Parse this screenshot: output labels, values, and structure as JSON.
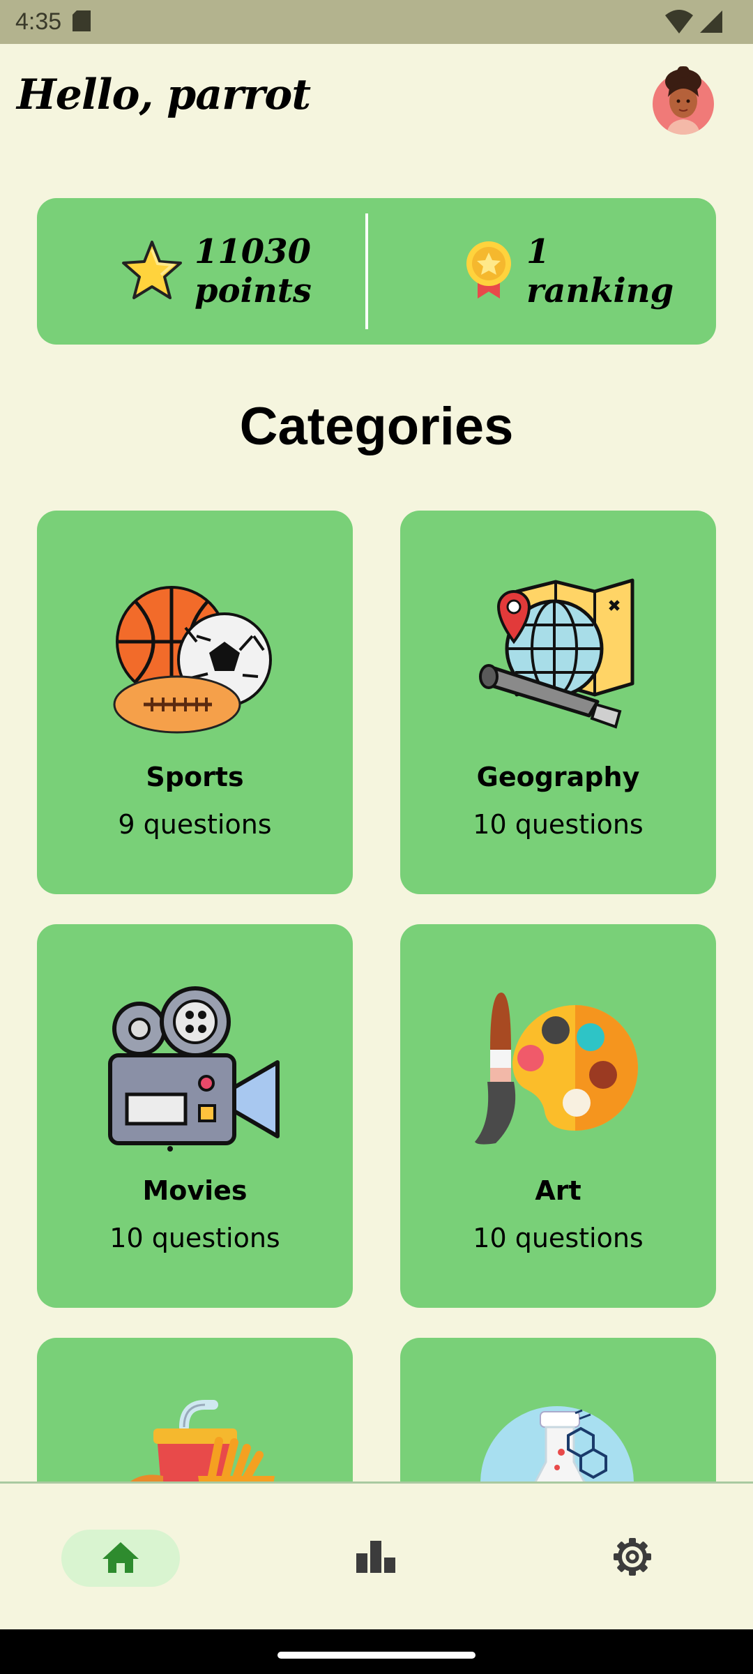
{
  "status_bar": {
    "time": "4:35"
  },
  "header": {
    "greeting": "Hello, parrot"
  },
  "stats": {
    "points_value": "11030",
    "points_label": "points",
    "ranking_value": "1",
    "ranking_label": "ranking"
  },
  "section_title": "Categories",
  "categories": [
    {
      "name": "Sports",
      "count": "9 questions",
      "icon": "sports-balls-icon"
    },
    {
      "name": "Geography",
      "count": "10 questions",
      "icon": "globe-map-icon"
    },
    {
      "name": "Movies",
      "count": "10 questions",
      "icon": "movie-camera-icon"
    },
    {
      "name": "Art",
      "count": "10 questions",
      "icon": "palette-brush-icon"
    },
    {
      "name": "",
      "count": "",
      "icon": "food-drink-icon"
    },
    {
      "name": "",
      "count": "",
      "icon": "science-flask-icon"
    }
  ],
  "bottom_nav": [
    {
      "name": "home",
      "icon": "home-icon",
      "active": true
    },
    {
      "name": "leaderboard",
      "icon": "bar-chart-icon",
      "active": false
    },
    {
      "name": "settings",
      "icon": "gear-icon",
      "active": false
    }
  ],
  "colors": {
    "background": "#f5f5de",
    "status_bar": "#b3b38e",
    "card_green": "#79d078",
    "nav_active_pill": "#d9f4d0",
    "nav_active_icon": "#2e8b2e",
    "nav_icon": "#3c3c3c"
  }
}
